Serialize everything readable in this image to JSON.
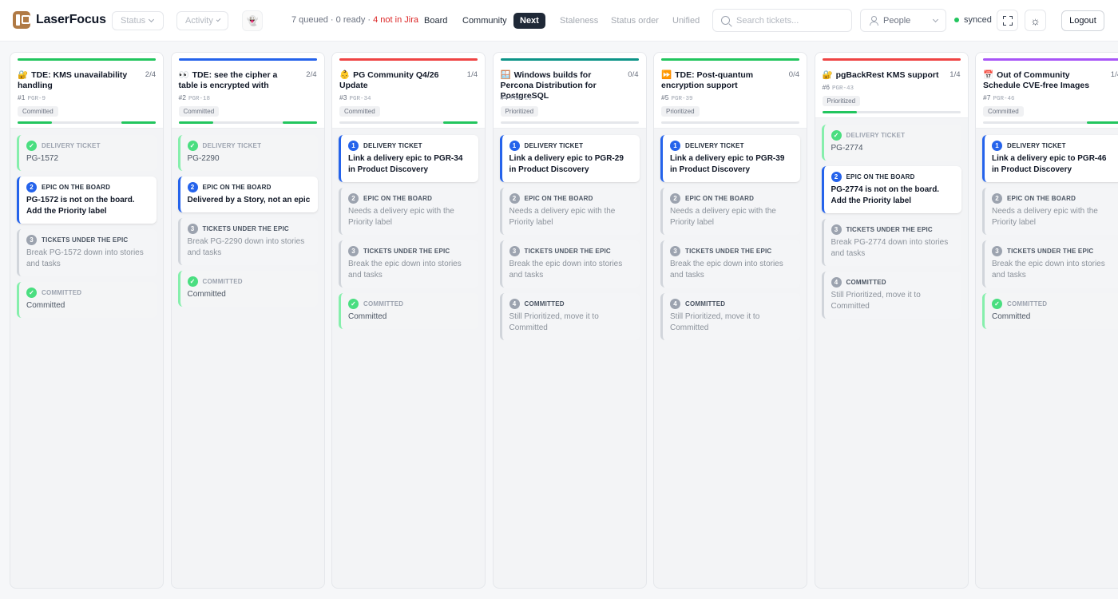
{
  "app": {
    "name": "LaserFocus"
  },
  "header": {
    "status_filter": "Status",
    "activity_filter": "Activity",
    "ghost_button": "👻",
    "stats": {
      "queued": "7 queued · 0 ready · ",
      "not_in_jira": "4 not in Jira"
    },
    "nav": {
      "board": "Board",
      "community": "Community",
      "next": "Next",
      "staleness": "Staleness",
      "status_order": "Status order",
      "unified": "Unified"
    },
    "search": {
      "placeholder": "Search tickets..."
    },
    "people": "People",
    "sync": "synced",
    "theme_icon": "☼",
    "logout": "Logout"
  },
  "colors": {
    "green": "#22c55e",
    "blue": "#2563eb",
    "red": "#ef4444",
    "teal": "#0d9488",
    "purple": "#a855f7",
    "done_border": "#86efac"
  },
  "columns": [
    {
      "emoji": "🔐",
      "title": "TDE: KMS unavailability handling",
      "count": "2/4",
      "num": "#1",
      "key": "PGR-9",
      "status": "Committed",
      "steps": [
        {
          "num": "✓",
          "state": "done",
          "label": "DELIVERY TICKET",
          "text": "PG-1572"
        },
        {
          "num": "2",
          "state": "active",
          "label": "EPIC ON THE BOARD",
          "text": "PG-1572 is not on the board. Add the Priority label"
        },
        {
          "num": "3",
          "state": "pending",
          "label": "TICKETS UNDER THE EPIC",
          "text": "Break PG-1572 down into stories and tasks"
        },
        {
          "num": "✓",
          "state": "done",
          "label": "COMMITTED",
          "text": "Committed"
        }
      ]
    },
    {
      "emoji": "👀",
      "title": "TDE: see the cipher a table is encrypted with",
      "count": "2/4",
      "num": "#2",
      "key": "PGR-18",
      "status": "Committed",
      "steps": [
        {
          "num": "✓",
          "state": "done",
          "label": "DELIVERY TICKET",
          "text": "PG-2290"
        },
        {
          "num": "2",
          "state": "active",
          "label": "EPIC ON THE BOARD",
          "text": "Delivered by a Story, not an epic"
        },
        {
          "num": "3",
          "state": "pending",
          "label": "TICKETS UNDER THE EPIC",
          "text": "Break PG-2290 down into stories and tasks"
        },
        {
          "num": "✓",
          "state": "done",
          "label": "COMMITTED",
          "text": "Committed"
        }
      ]
    },
    {
      "emoji": "👶",
      "title": "PG Community Q4/26 Update",
      "count": "1/4",
      "num": "#3",
      "key": "PGR-34",
      "status": "Committed",
      "steps": [
        {
          "num": "1",
          "state": "active",
          "label": "DELIVERY TICKET",
          "text": "Link a delivery epic to PGR-34 in Product Discovery"
        },
        {
          "num": "2",
          "state": "pending",
          "label": "EPIC ON THE BOARD",
          "text": "Needs a delivery epic with the Priority label"
        },
        {
          "num": "3",
          "state": "pending",
          "label": "TICKETS UNDER THE EPIC",
          "text": "Break the epic down into stories and tasks"
        },
        {
          "num": "✓",
          "state": "done",
          "label": "COMMITTED",
          "text": "Committed"
        }
      ]
    },
    {
      "emoji": "🪟",
      "title": "Windows builds for Percona Distribution for PostgreSQL",
      "count": "0/4",
      "num": "#4",
      "key": "PGR-29",
      "status": "Prioritized",
      "steps": [
        {
          "num": "1",
          "state": "active",
          "label": "DELIVERY TICKET",
          "text": "Link a delivery epic to PGR-29 in Product Discovery"
        },
        {
          "num": "2",
          "state": "pending",
          "label": "EPIC ON THE BOARD",
          "text": "Needs a delivery epic with the Priority label"
        },
        {
          "num": "3",
          "state": "pending",
          "label": "TICKETS UNDER THE EPIC",
          "text": "Break the epic down into stories and tasks"
        },
        {
          "num": "4",
          "state": "pending",
          "label": "COMMITTED",
          "text": "Still Prioritized, move it to Committed"
        }
      ]
    },
    {
      "emoji": "⏩",
      "title": "TDE: Post-quantum encryption support",
      "count": "0/4",
      "num": "#5",
      "key": "PGR-39",
      "status": "Prioritized",
      "steps": [
        {
          "num": "1",
          "state": "active",
          "label": "DELIVERY TICKET",
          "text": "Link a delivery epic to PGR-39 in Product Discovery"
        },
        {
          "num": "2",
          "state": "pending",
          "label": "EPIC ON THE BOARD",
          "text": "Needs a delivery epic with the Priority label"
        },
        {
          "num": "3",
          "state": "pending",
          "label": "TICKETS UNDER THE EPIC",
          "text": "Break the epic down into stories and tasks"
        },
        {
          "num": "4",
          "state": "pending",
          "label": "COMMITTED",
          "text": "Still Prioritized, move it to Committed"
        }
      ]
    },
    {
      "emoji": "🔐",
      "title": "pgBackRest KMS support",
      "count": "1/4",
      "num": "#6",
      "key": "PGR-43",
      "status": "Prioritized",
      "steps": [
        {
          "num": "✓",
          "state": "done",
          "label": "DELIVERY TICKET",
          "text": "PG-2774"
        },
        {
          "num": "2",
          "state": "active",
          "label": "EPIC ON THE BOARD",
          "text": "PG-2774 is not on the board. Add the Priority label"
        },
        {
          "num": "3",
          "state": "pending",
          "label": "TICKETS UNDER THE EPIC",
          "text": "Break PG-2774 down into stories and tasks"
        },
        {
          "num": "4",
          "state": "pending",
          "label": "COMMITTED",
          "text": "Still Prioritized, move it to Committed"
        }
      ]
    },
    {
      "emoji": "📅",
      "title": "Out of Community Schedule CVE-free Images",
      "count": "1/4",
      "num": "#7",
      "key": "PGR-46",
      "status": "Committed",
      "steps": [
        {
          "num": "1",
          "state": "active",
          "label": "DELIVERY TICKET",
          "text": "Link a delivery epic to PGR-46 in Product Discovery"
        },
        {
          "num": "2",
          "state": "pending",
          "label": "EPIC ON THE BOARD",
          "text": "Needs a delivery epic with the Priority label"
        },
        {
          "num": "3",
          "state": "pending",
          "label": "TICKETS UNDER THE EPIC",
          "text": "Break the epic down into stories and tasks"
        },
        {
          "num": "✓",
          "state": "done",
          "label": "COMMITTED",
          "text": "Committed"
        }
      ]
    }
  ]
}
